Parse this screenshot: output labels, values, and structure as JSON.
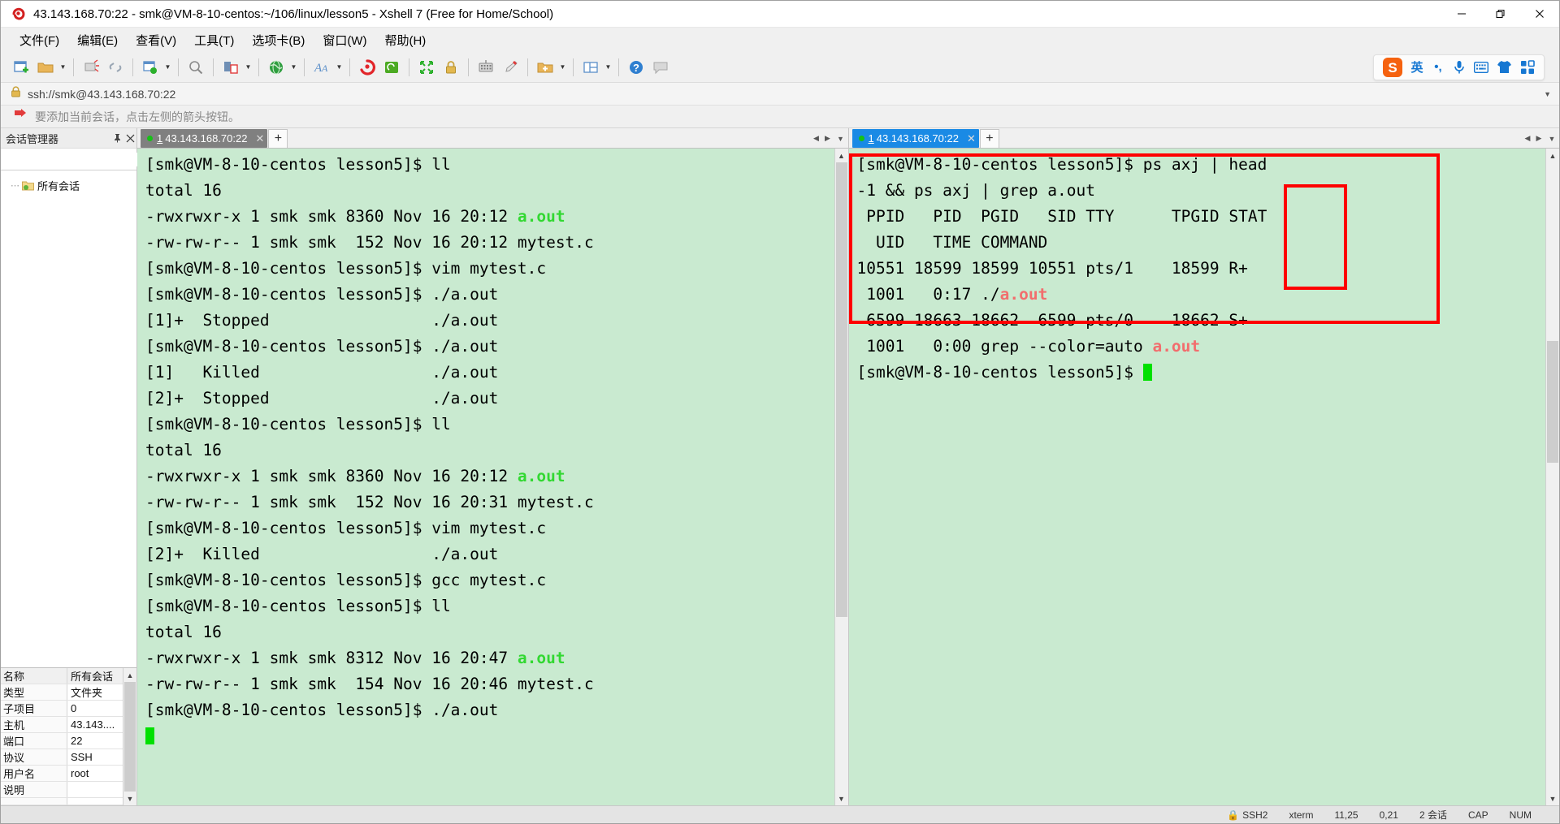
{
  "window": {
    "title": "43.143.168.70:22 - smk@VM-8-10-centos:~/106/linux/lesson5 - Xshell 7 (Free for Home/School)",
    "app_icon": "xshell-logo-icon",
    "minimize": "—",
    "maximize": "❐",
    "close": "✕"
  },
  "menu": {
    "items": [
      {
        "label": "文件(F)",
        "name": "menu-file"
      },
      {
        "label": "编辑(E)",
        "name": "menu-edit"
      },
      {
        "label": "查看(V)",
        "name": "menu-view"
      },
      {
        "label": "工具(T)",
        "name": "menu-tools"
      },
      {
        "label": "选项卡(B)",
        "name": "menu-tab"
      },
      {
        "label": "窗口(W)",
        "name": "menu-window"
      },
      {
        "label": "帮助(H)",
        "name": "menu-help"
      }
    ]
  },
  "toolbar": {
    "buttons": [
      {
        "name": "new-session-icon",
        "title": "新建"
      },
      {
        "name": "open-folder-icon",
        "title": "打开"
      },
      {
        "name": "disconnect-icon",
        "title": "断开"
      },
      {
        "name": "reconnect-icon",
        "title": "重新连接"
      },
      {
        "name": "session-properties-icon",
        "title": "属性"
      },
      {
        "name": "find-icon",
        "title": "查找"
      },
      {
        "name": "file-transfer-icon",
        "title": "传输"
      },
      {
        "name": "globe-icon",
        "title": "浏览"
      },
      {
        "name": "font-icon",
        "title": "字体"
      },
      {
        "name": "sogou-red-icon",
        "title": "输入法"
      },
      {
        "name": "green-sync-icon",
        "title": "同步"
      },
      {
        "name": "fullscreen-icon",
        "title": "全屏"
      },
      {
        "name": "lock-icon",
        "title": "锁定"
      },
      {
        "name": "keyboard-icon",
        "title": "键盘"
      },
      {
        "name": "highlight-pen-icon",
        "title": "高亮"
      },
      {
        "name": "add-folder-icon",
        "title": "新建文件夹"
      },
      {
        "name": "layout-icon",
        "title": "布局"
      },
      {
        "name": "help-icon",
        "title": "帮助"
      },
      {
        "name": "chat-icon",
        "title": "反馈"
      }
    ]
  },
  "ime": {
    "logo": "sogou-logo-icon",
    "items": [
      {
        "name": "ime-lang-toggle",
        "glyph": "英"
      },
      {
        "name": "ime-punctuation",
        "glyph": "•,"
      },
      {
        "name": "ime-voice-input-icon",
        "glyph": "Ἲ4"
      },
      {
        "name": "ime-soft-keyboard-icon",
        "glyph": "⌨"
      },
      {
        "name": "ime-skin-icon",
        "glyph": "ὅ5"
      },
      {
        "name": "ime-toolbox-icon",
        "glyph": "▦"
      }
    ]
  },
  "address": {
    "lock_icon": "lock-icon",
    "url": "ssh://smk@43.143.168.70:22"
  },
  "notification": {
    "icon": "red-arrow-icon",
    "text": "要添加当前会话，点击左侧的箭头按钮。"
  },
  "session_panel": {
    "title": "会话管理器",
    "pin_icon": "pin-icon",
    "close_icon": "close-icon",
    "search_placeholder": "",
    "search_value": "",
    "search_icon": "search-icon",
    "tree": [
      {
        "label": "所有会话",
        "icon": "folder-gear-icon"
      }
    ],
    "properties": [
      {
        "key": "名称",
        "value": "所有会话"
      },
      {
        "key": "类型",
        "value": "文件夹"
      },
      {
        "key": "子项目",
        "value": "0"
      },
      {
        "key": "主机",
        "value": "43.143...."
      },
      {
        "key": "端口",
        "value": "22"
      },
      {
        "key": "协议",
        "value": "SSH"
      },
      {
        "key": "用户名",
        "value": "root"
      },
      {
        "key": "说明",
        "value": ""
      }
    ]
  },
  "left_pane": {
    "tabs": [
      {
        "num": "1",
        "label": "43.143.168.70:22",
        "active": false,
        "status": "connected"
      }
    ],
    "new_tab_label": "+",
    "nav_prev": "◀",
    "nav_next": "▶",
    "nav_menu": "▼",
    "terminal_lines": [
      [
        {
          "t": "[smk@VM-8-10-centos lesson5]$ ll"
        }
      ],
      [
        {
          "t": "total 16"
        }
      ],
      [
        {
          "t": "-rwxrwxr-x 1 smk smk 8360 Nov 16 20:12 "
        },
        {
          "t": "a.out",
          "c": "green"
        }
      ],
      [
        {
          "t": "-rw-rw-r-- 1 smk smk  152 Nov 16 20:12 mytest.c"
        }
      ],
      [
        {
          "t": "[smk@VM-8-10-centos lesson5]$ vim mytest.c"
        }
      ],
      [
        {
          "t": "[smk@VM-8-10-centos lesson5]$ ./a.out"
        }
      ],
      [
        {
          "t": ""
        }
      ],
      [
        {
          "t": "[1]+  Stopped                 ./a.out"
        }
      ],
      [
        {
          "t": "[smk@VM-8-10-centos lesson5]$ ./a.out"
        }
      ],
      [
        {
          "t": "[1]   Killed                  ./a.out"
        }
      ],
      [
        {
          "t": ""
        }
      ],
      [
        {
          "t": "[2]+  Stopped                 ./a.out"
        }
      ],
      [
        {
          "t": "[smk@VM-8-10-centos lesson5]$ ll"
        }
      ],
      [
        {
          "t": "total 16"
        }
      ],
      [
        {
          "t": "-rwxrwxr-x 1 smk smk 8360 Nov 16 20:12 "
        },
        {
          "t": "a.out",
          "c": "green"
        }
      ],
      [
        {
          "t": "-rw-rw-r-- 1 smk smk  152 Nov 16 20:31 mytest.c"
        }
      ],
      [
        {
          "t": "[smk@VM-8-10-centos lesson5]$ vim mytest.c"
        }
      ],
      [
        {
          "t": "[2]+  Killed                  ./a.out"
        }
      ],
      [
        {
          "t": "[smk@VM-8-10-centos lesson5]$ gcc mytest.c"
        }
      ],
      [
        {
          "t": "[smk@VM-8-10-centos lesson5]$ ll"
        }
      ],
      [
        {
          "t": "total 16"
        }
      ],
      [
        {
          "t": "-rwxrwxr-x 1 smk smk 8312 Nov 16 20:47 "
        },
        {
          "t": "a.out",
          "c": "green"
        }
      ],
      [
        {
          "t": "-rw-rw-r-- 1 smk smk  154 Nov 16 20:46 mytest.c"
        }
      ],
      [
        {
          "t": "[smk@VM-8-10-centos lesson5]$ ./a.out"
        }
      ],
      [
        {
          "t": "",
          "cursor": true
        }
      ]
    ]
  },
  "right_pane": {
    "tabs": [
      {
        "num": "1",
        "label": "43.143.168.70:22",
        "active": true,
        "status": "connected"
      }
    ],
    "new_tab_label": "+",
    "terminal_lines": [
      [
        {
          "t": "[smk@VM-8-10-centos lesson5]$ ps axj | head"
        }
      ],
      [
        {
          "t": "-1 && ps axj | grep a.out"
        }
      ],
      [
        {
          "t": " PPID   PID  PGID   SID TTY      TPGID STAT"
        }
      ],
      [
        {
          "t": "  UID   TIME COMMAND"
        }
      ],
      [
        {
          "t": "10551 18599 18599 10551 pts/1    18599 R+"
        }
      ],
      [
        {
          "t": " 1001   0:17 ./"
        },
        {
          "t": "a.out",
          "c": "salmon"
        }
      ],
      [
        {
          "t": " 6599 18663 18662  6599 pts/0    18662 S+"
        }
      ],
      [
        {
          "t": " 1001   0:00 grep --color=auto "
        },
        {
          "t": "a.out",
          "c": "salmon"
        }
      ],
      [
        {
          "t": "[smk@VM-8-10-centos lesson5]$ ",
          "cursor": true
        }
      ]
    ],
    "annotations": [
      {
        "name": "ps-output-highlight-box",
        "color": "#fe0000"
      },
      {
        "name": "stat-column-highlight-box",
        "color": "#fe0000"
      }
    ]
  },
  "statusbar": {
    "protocol": "SSH2",
    "host_key": "xterm",
    "cursor": "11,25",
    "session_count": "0,21",
    "encoding": "2 会话",
    "caps": "CAP",
    "num": "NUM"
  },
  "colors": {
    "terminal_bg": "#c9ead0",
    "terminal_fg": "#000000",
    "accent_green": "#32d832",
    "accent_salmon": "#f26d6d",
    "annotation_red": "#fe0000",
    "tab_active": "#1a8ae5",
    "tab_inactive": "#808080",
    "cursor": "#00e000"
  }
}
